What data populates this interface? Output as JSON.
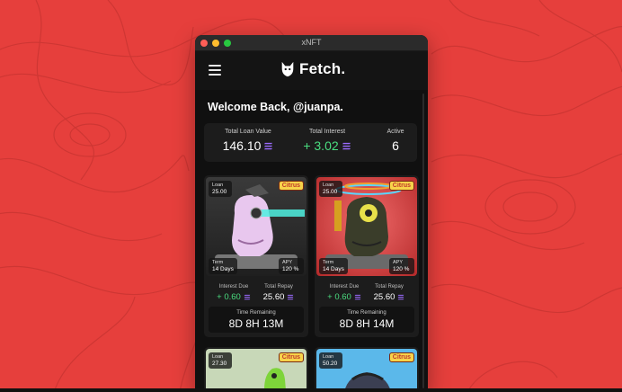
{
  "window": {
    "title": "xNFT"
  },
  "header": {
    "logo_text": "Fetch."
  },
  "welcome": "Welcome Back, @juanpa.",
  "stats": {
    "total_loan_label": "Total Loan Value",
    "total_loan_value": "146.10",
    "total_interest_label": "Total Interest",
    "total_interest_value": "+ 3.02",
    "active_label": "Active",
    "active_value": "6"
  },
  "cards": [
    {
      "loan_label": "Loan",
      "loan_value": "25.00",
      "brand": "Citrus",
      "term_label": "Term",
      "term_value": "14 Days",
      "apy_label": "APY",
      "apy_value": "120 %",
      "interest_due_label": "Interest Due",
      "interest_due_value": "+ 0.60",
      "total_repay_label": "Total Repay",
      "total_repay_value": "25.60",
      "time_label": "Time Remaining",
      "time_value": "8D 8H 13M"
    },
    {
      "loan_label": "Loan",
      "loan_value": "25.00",
      "brand": "Citrus",
      "term_label": "Term",
      "term_value": "14 Days",
      "apy_label": "APY",
      "apy_value": "120 %",
      "interest_due_label": "Interest Due",
      "interest_due_value": "+ 0.60",
      "total_repay_label": "Total Repay",
      "total_repay_value": "25.60",
      "time_label": "Time Remaining",
      "time_value": "8D 8H 14M"
    },
    {
      "loan_label": "Loan",
      "loan_value": "27.30",
      "brand": "Citrus"
    },
    {
      "loan_label": "Loan",
      "loan_value": "50.20",
      "brand": "Citrus"
    }
  ],
  "colors": {
    "background": "#e63f3c",
    "window": "#121212",
    "panel": "#1c1c1c",
    "positive": "#4ade80",
    "brand_badge": "#f7d34a"
  },
  "icons": [
    "menu-icon",
    "fetch-logo-icon",
    "solana-icon",
    "close-dot",
    "minimize-dot",
    "zoom-dot"
  ]
}
